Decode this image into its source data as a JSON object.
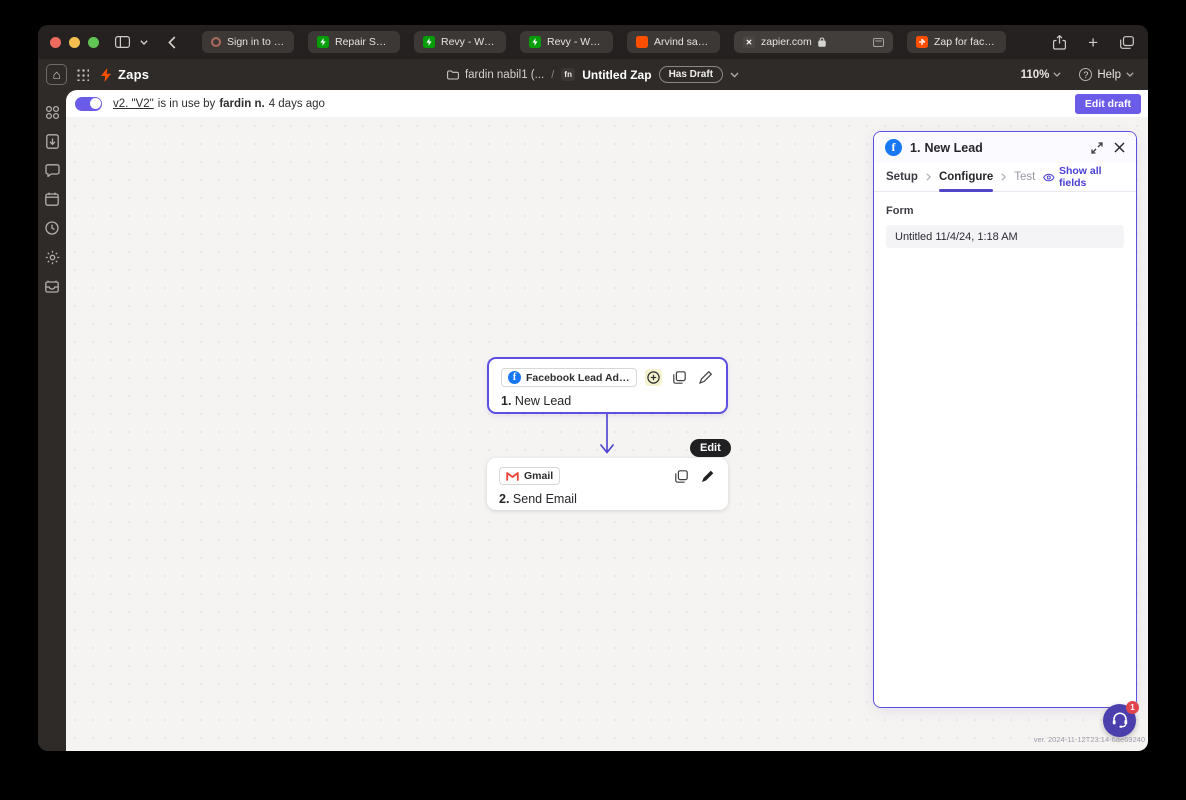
{
  "browser": {
    "tabs": [
      {
        "label": "Sign in to your P..."
      },
      {
        "label": "Repair Service..."
      },
      {
        "label": "Revy - WordPre..."
      },
      {
        "label": "Revy - WordPre..."
      },
      {
        "label": "Arvind says..."
      },
      {
        "label": "zapier.com"
      },
      {
        "label": "Zap for faceboo..."
      }
    ]
  },
  "header": {
    "app_title": "Zaps",
    "breadcrumb": {
      "account": "fardin nabil1 (...",
      "separator": "/",
      "workspace_badge": "fn",
      "zap_name": "Untitled Zap",
      "status_badge": "Has Draft"
    },
    "zoom_level": "110%",
    "help_label": "Help"
  },
  "banner": {
    "version_link": "v2. \"V2\"",
    "middle_text": "is in use by",
    "user_name": "fardin n.",
    "time_ago": "4 days ago",
    "edit_draft_label": "Edit draft"
  },
  "canvas": {
    "step1": {
      "app_name": "Facebook Lead Ads (for Busin...",
      "number": "1.",
      "title": "New Lead"
    },
    "step2": {
      "app_name": "Gmail",
      "number": "2.",
      "title": "Send Email"
    },
    "edit_tooltip": "Edit",
    "version_text": "ver. 2024-11-12T23:14-6ae69240",
    "chat_badge_count": "1"
  },
  "panel": {
    "step_number": "1.",
    "step_title": "New Lead",
    "tabs": [
      {
        "label": "Setup"
      },
      {
        "label": "Configure"
      },
      {
        "label": "Test"
      }
    ],
    "show_all_fields_label": "Show all fields",
    "form": {
      "label": "Form",
      "value": "Untitled 11/4/24, 1:18 AM"
    }
  },
  "colors": {
    "accent": "#5d50e0",
    "accent_button": "#6a5be8",
    "facebook_blue": "#1877f2",
    "zapier_orange": "#ff4f00",
    "notification_red": "#e0454b"
  }
}
